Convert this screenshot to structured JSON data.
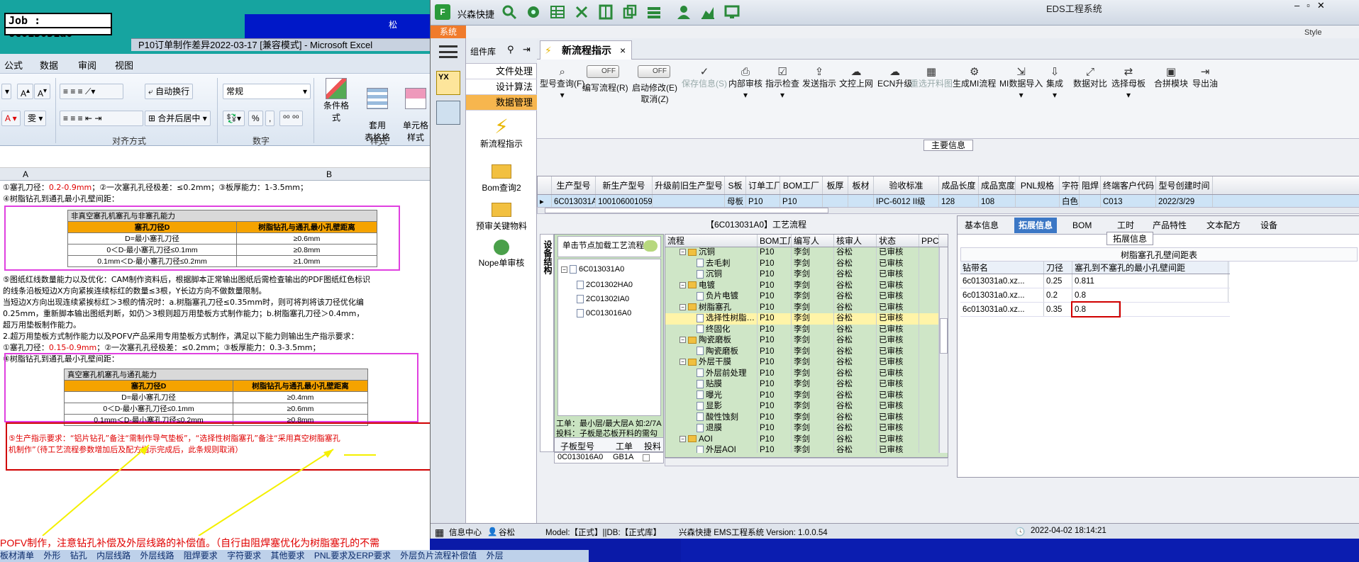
{
  "excel": {
    "job_label": "Job : 6c013031a0",
    "song": "松",
    "title": "P10订单制作差异2022-03-17  [兼容模式] - Microsoft Excel",
    "menu": [
      "公式",
      "数据",
      "审阅",
      "视图"
    ],
    "ribbon": {
      "wrap": "自动换行",
      "merge": "合并后居中",
      "format_value": "常规",
      "percent": "%",
      "comma": ",",
      "cond_format": "条件格式",
      "table_format": "套用\n表格格式",
      "cell_style": "单元格\n样式",
      "groups": [
        "对齐方式",
        "数字",
        "样式"
      ]
    },
    "cols": [
      "A",
      "B"
    ],
    "lines": [
      {
        "t": "①塞孔刀径：",
        "r": "0.2-0.9mm",
        "t2": "；②一次塞孔孔径极差：≤0.2mm；③板厚能力：1-3.5mm；"
      },
      {
        "t": "④树脂钻孔到通孔最小孔壁间距："
      },
      {
        "t": "⑤图纸红线数量能力以及优化：CAM制作资料后，根据脚本正常输出图纸后需检查输出的PDF图纸红色标识"
      },
      {
        "t": "的线条沿板短边X方向紧挨连续标红的数量≤3根，Y长边方向不做数量限制。"
      },
      {
        "t": "当短边X方向出现连续紧挨标红＞3根的情况时：a.树脂塞孔刀径≤0.35mm时，则可将判将该刀径优化编"
      },
      {
        "t": "0.25mm，重新脚本输出图纸判断，如仍＞3根则超万用垫板方式制作能力；b.树脂塞孔刀径＞0.4mm，"
      },
      {
        "t": "超万用垫板制作能力。"
      },
      {
        "t": "2.超万用垫板方式制作能力以及POFV产品采用专用垫板方式制作，满足以下能力则输出生产指示要求："
      },
      {
        "t": "①塞孔刀径：",
        "r": "0.15-0.9mm",
        "t2": "；②一次塞孔孔径极差：≤0.2mm；③板厚能力：0.3-3.5mm；"
      },
      {
        "t": "④树脂钻孔到通孔最小孔壁间距："
      }
    ],
    "table1": {
      "caption": "非真空塞孔机塞孔与非塞孔能力",
      "headers": [
        "塞孔刀径D",
        "树脂钻孔与通孔最小孔壁距离"
      ],
      "rows": [
        [
          "D=最小塞孔刀径",
          "≥0.6mm"
        ],
        [
          "0＜D-最小塞孔刀径≤0.1mm",
          "≥0.8mm"
        ],
        [
          "0.1mm＜D-最小塞孔刀径≤0.2mm",
          "≥1.0mm"
        ]
      ]
    },
    "table2": {
      "caption": "真空塞孔机塞孔与通孔能力",
      "headers": [
        "塞孔刀径D",
        "树脂钻孔与通孔最小孔壁距离"
      ],
      "rows": [
        [
          "D=最小塞孔刀径",
          "≥0.4mm"
        ],
        [
          "0＜D-最小塞孔刀径≤0.1mm",
          "≥0.6mm"
        ],
        [
          "0.1mm＜D-最小塞孔刀径≤0.2mm",
          "≥0.8mm"
        ]
      ]
    },
    "red_note1": "⑤生产指示要求：“铝片钻孔”备注“需制作导气垫板”，“选择性树脂塞孔”备注“采用真空树脂塞孔",
    "red_note2": "机制作”（待工艺流程参数增加后及配方指示完成后，此条规则取消）",
    "bottom_red": "POFV制作，注意钻孔补偿及外层线路的补偿值。（自行由阻焊塞优化为树脂塞孔的不需",
    "sheet_tabs": [
      "板材清单",
      "外形",
      "钻孔",
      "内层线路",
      "外层线路",
      "阻焊要求",
      "字符要求",
      "其他要求",
      "PNL要求及ERP要求",
      "外层负片流程补偿值",
      "外层"
    ]
  },
  "eds": {
    "app_name": "兴森快捷",
    "window_title": "EDS工程系统",
    "right_title_hint": "Style",
    "sys_tab": "系统",
    "complib_label": "组件库",
    "complib_items": [
      "文件处理",
      "设计算法",
      "数据管理"
    ],
    "complib_tools": [
      "新流程指示",
      "Bom查询2",
      "预审关键物料",
      "Nope单审核"
    ],
    "tab_label": "新流程指示",
    "toolbar": [
      {
        "label": "型号查询(F)",
        "ic": "⌕",
        "dd": "▾"
      },
      {
        "label": "编写流程(R)",
        "tog": "OFF"
      },
      {
        "label": "启动修改(E)",
        "tog": "OFF",
        "sub": "取消(Z)"
      },
      {
        "label": "保存信息(S)",
        "ic": "✓",
        "dis": true
      },
      {
        "label": "内部审核",
        "ic": "⎙",
        "dd": "▾"
      },
      {
        "label": "指示检查",
        "ic": "☑",
        "dd": "▾"
      },
      {
        "label": "发送指示",
        "ic": "⇪"
      },
      {
        "label": "文控上网",
        "ic": "☁"
      },
      {
        "label": "ECN升级",
        "ic": "☁"
      },
      {
        "label": "重选开料图",
        "ic": "▦",
        "dis": true
      },
      {
        "label": "生成MI流程",
        "ic": "⚙"
      },
      {
        "label": "MI数据导入",
        "ic": "⇲",
        "dd": "▾"
      },
      {
        "label": "集成",
        "ic": "⇩",
        "dd": "▾"
      },
      {
        "label": "数据对比",
        "ic": "⤢"
      },
      {
        "label": "选择母板",
        "ic": "⇄",
        "dd": "▾"
      },
      {
        "label": "合拼模块",
        "ic": "▣"
      },
      {
        "label": "导出油",
        "ic": "⇥"
      }
    ],
    "main_info_title": "主要信息",
    "main_grid": {
      "headers": [
        "生产型号",
        "新生产型号",
        "升级前旧生产型号",
        "S板",
        "订单工厂",
        "BOM工厂",
        "板厚",
        "板材",
        "验收标准",
        "成品长度",
        "成品宽度",
        "PNL规格",
        "字符",
        "阻焊",
        "终端客户代码",
        "型号创建时间"
      ],
      "row": [
        "6C013031A0",
        "10010600105918",
        "",
        "母板",
        "P10",
        "P10",
        "",
        "",
        "IPC-6012 II级",
        "128",
        "108",
        "",
        "白色",
        "",
        "C013",
        "2022/3/29"
      ]
    },
    "proc_title": "【6C013031A0】工艺流程",
    "side_vert": "设备结构",
    "tree": {
      "hint": "单击节点加载工艺流程",
      "root": "6C013031A0",
      "children": [
        "2C01302HA0",
        "2C01302IA0",
        "0C013016A0"
      ],
      "info1": "工单：最小层/最大层A 如:2/7A",
      "info2": "投料：子板是芯板开料的需勾选",
      "sub_headers": [
        "子板型号",
        "工单",
        "投料"
      ],
      "sub_row": [
        "0C013016A0",
        "GB1A",
        ""
      ]
    },
    "proc_grid": {
      "headers": [
        "流程",
        "BOM工厂",
        "编写人",
        "核审人",
        "状态",
        "PPC"
      ],
      "rows": [
        {
          "n": "沉铜",
          "lvl": 0,
          "f": true,
          "w": "P10",
          "a": "李剑",
          "b": "谷松",
          "s": "已审核"
        },
        {
          "n": "去毛刺",
          "lvl": 1,
          "w": "P10",
          "a": "李剑",
          "b": "谷松",
          "s": "已审核"
        },
        {
          "n": "沉铜",
          "lvl": 1,
          "w": "P10",
          "a": "李剑",
          "b": "谷松",
          "s": "已审核"
        },
        {
          "n": "电镀",
          "lvl": 0,
          "f": true,
          "w": "P10",
          "a": "李剑",
          "b": "谷松",
          "s": "已审核"
        },
        {
          "n": "负片电镀",
          "lvl": 1,
          "w": "P10",
          "a": "李剑",
          "b": "谷松",
          "s": "已审核"
        },
        {
          "n": "树脂塞孔",
          "lvl": 0,
          "f": true,
          "w": "P10",
          "a": "李剑",
          "b": "谷松",
          "s": "已审核"
        },
        {
          "n": "选择性树脂…",
          "lvl": 1,
          "sel": true,
          "w": "P10",
          "a": "李剑",
          "b": "谷松",
          "s": "已审核"
        },
        {
          "n": "终固化",
          "lvl": 1,
          "w": "P10",
          "a": "李剑",
          "b": "谷松",
          "s": "已审核"
        },
        {
          "n": "陶瓷磨板",
          "lvl": 0,
          "f": true,
          "w": "P10",
          "a": "李剑",
          "b": "谷松",
          "s": "已审核"
        },
        {
          "n": "陶瓷磨板",
          "lvl": 1,
          "w": "P10",
          "a": "李剑",
          "b": "谷松",
          "s": "已审核"
        },
        {
          "n": "外层干膜",
          "lvl": 0,
          "f": true,
          "w": "P10",
          "a": "李剑",
          "b": "谷松",
          "s": "已审核"
        },
        {
          "n": "外层前处理",
          "lvl": 1,
          "w": "P10",
          "a": "李剑",
          "b": "谷松",
          "s": "已审核"
        },
        {
          "n": "贴膜",
          "lvl": 1,
          "w": "P10",
          "a": "李剑",
          "b": "谷松",
          "s": "已审核"
        },
        {
          "n": "曝光",
          "lvl": 1,
          "w": "P10",
          "a": "李剑",
          "b": "谷松",
          "s": "已审核"
        },
        {
          "n": "显影",
          "lvl": 1,
          "w": "P10",
          "a": "李剑",
          "b": "谷松",
          "s": "已审核"
        },
        {
          "n": "酸性蚀刻",
          "lvl": 1,
          "w": "P10",
          "a": "李剑",
          "b": "谷松",
          "s": "已审核"
        },
        {
          "n": "退膜",
          "lvl": 1,
          "w": "P10",
          "a": "李剑",
          "b": "谷松",
          "s": "已审核"
        },
        {
          "n": "AOI",
          "lvl": 0,
          "f": true,
          "w": "P10",
          "a": "李剑",
          "b": "谷松",
          "s": "已审核"
        },
        {
          "n": "外层AOI",
          "lvl": 1,
          "w": "P10",
          "a": "李剑",
          "b": "谷松",
          "s": "已审核"
        },
        {
          "n": "阻焊",
          "lvl": 0,
          "f": true,
          "w": "P10",
          "a": "李剑",
          "b": "谷松",
          "s": "已审核"
        }
      ]
    },
    "right_tabs": [
      "基本信息",
      "拓展信息",
      "BOM",
      "工时",
      "产品特性",
      "文本配方",
      "设备"
    ],
    "right_sel": 1,
    "ext_title": "拓展信息",
    "ext_table_title": "树脂塞孔孔壁间距表",
    "ext_headers": [
      "钻带名",
      "刀径",
      "塞孔到不塞孔的最小孔壁间距"
    ],
    "ext_rows": [
      [
        "6c013031a0.xz...",
        "0.25",
        "0.811"
      ],
      [
        "6c013031a0.xz...",
        "0.2",
        "0.8"
      ],
      [
        "6c013031a0.xz...",
        "0.35",
        "0.8"
      ]
    ],
    "status": {
      "info": "信息中心",
      "user": "谷松",
      "model": "Model:【正式】||DB:【正式库】",
      "ver": "兴森快捷  EMS工程系统  Version: 1.0.0.54",
      "time": "2022-04-02 18:14:21"
    }
  }
}
